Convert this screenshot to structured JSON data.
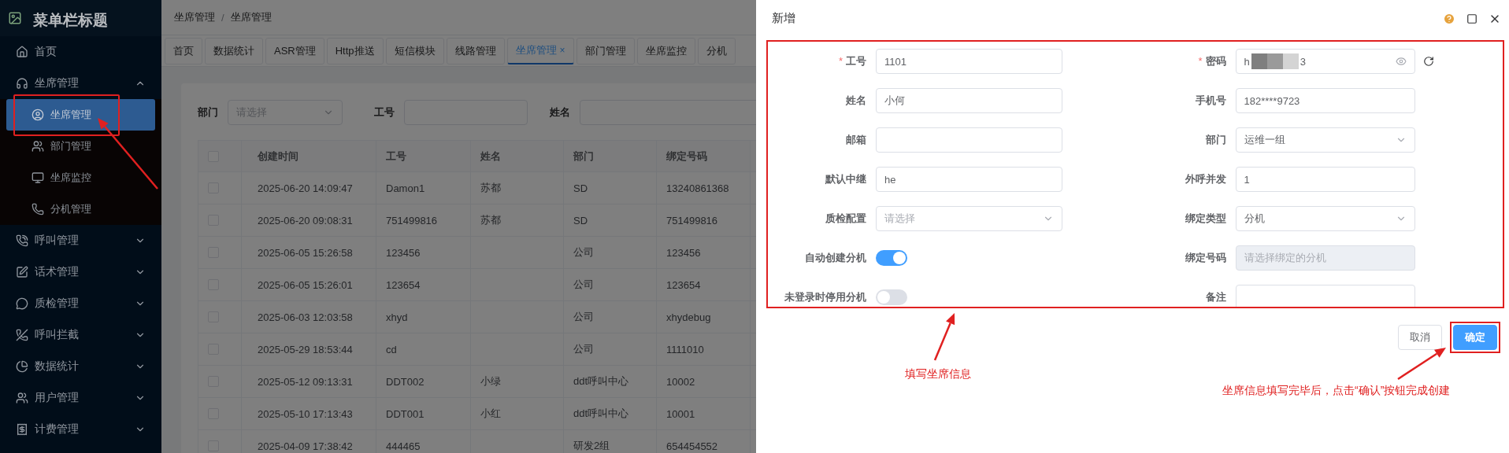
{
  "sidebar": {
    "title": "菜单栏标题",
    "items": [
      {
        "label": "首页",
        "kind": "link",
        "selected": false
      },
      {
        "label": "坐席管理",
        "kind": "group",
        "selected": false,
        "expanded": true,
        "children": [
          {
            "label": "坐席管理",
            "selected": true
          },
          {
            "label": "部门管理",
            "selected": false
          },
          {
            "label": "坐席监控",
            "selected": false
          },
          {
            "label": "分机管理",
            "selected": false
          }
        ]
      },
      {
        "label": "呼叫管理",
        "kind": "group",
        "selected": false,
        "expanded": false
      },
      {
        "label": "话术管理",
        "kind": "group",
        "selected": false,
        "expanded": false
      },
      {
        "label": "质检管理",
        "kind": "group",
        "selected": false,
        "expanded": false
      },
      {
        "label": "呼叫拦截",
        "kind": "group",
        "selected": false,
        "expanded": false
      },
      {
        "label": "数据统计",
        "kind": "group",
        "selected": false,
        "expanded": false
      },
      {
        "label": "用户管理",
        "kind": "group",
        "selected": false,
        "expanded": false
      },
      {
        "label": "计费管理",
        "kind": "group",
        "selected": false,
        "expanded": false
      }
    ]
  },
  "breadcrumb": {
    "items": [
      "坐席管理",
      "坐席管理"
    ],
    "separator": "/"
  },
  "tabs": [
    {
      "label": "首页",
      "selected": false
    },
    {
      "label": "数据统计",
      "selected": false
    },
    {
      "label": "ASR管理",
      "selected": false
    },
    {
      "label": "Http推送",
      "selected": false
    },
    {
      "label": "短信模块",
      "selected": false
    },
    {
      "label": "线路管理",
      "selected": false
    },
    {
      "label": "坐席管理",
      "selected": true,
      "close": "×"
    },
    {
      "label": "部门管理",
      "selected": false
    },
    {
      "label": "坐席监控",
      "selected": false
    },
    {
      "label": "分机",
      "selected": false
    }
  ],
  "filters": [
    {
      "label": "部门",
      "kind": "select",
      "placeholder": "请选择"
    },
    {
      "label": "工号",
      "kind": "input"
    },
    {
      "label": "姓名",
      "kind": "input"
    }
  ],
  "table": {
    "columns": [
      "创建时间",
      "工号",
      "姓名",
      "部门",
      "绑定号码"
    ],
    "all_checked": false,
    "rows": [
      {
        "checked": false,
        "created": "2025-06-20 14:09:47",
        "id": "Damon1",
        "name": "苏都",
        "dept": "SD",
        "number": "13240861368"
      },
      {
        "checked": false,
        "created": "2025-06-20 09:08:31",
        "id": "751499816",
        "name": "苏都",
        "dept": "SD",
        "number": "751499816"
      },
      {
        "checked": false,
        "created": "2025-06-05 15:26:58",
        "id": "123456",
        "dept": "公司",
        "number": "123456"
      },
      {
        "checked": false,
        "created": "2025-06-05 15:26:01",
        "id": "123654",
        "dept": "公司",
        "number": "123654"
      },
      {
        "checked": false,
        "created": "2025-06-03 12:03:58",
        "id": "xhyd",
        "dept": "公司",
        "number": "xhydebug"
      },
      {
        "checked": false,
        "created": "2025-05-29 18:53:44",
        "id": "cd",
        "dept": "公司",
        "number": "1111010"
      },
      {
        "checked": false,
        "created": "2025-05-12 09:13:31",
        "id": "DDT002",
        "name": "小绿",
        "dept": "ddt呼叫中心",
        "number": "10002"
      },
      {
        "checked": false,
        "created": "2025-05-10 17:13:43",
        "id": "DDT001",
        "name": "小红",
        "dept": "ddt呼叫中心",
        "number": "10001"
      },
      {
        "checked": false,
        "created": "2025-04-09 17:38:42",
        "id": "444465",
        "dept": "研发2组",
        "number": "654454552"
      }
    ]
  },
  "dialog": {
    "title": "新增",
    "required_mark": "*",
    "fields": [
      {
        "label": "工号",
        "kind": "input",
        "required": true,
        "value": "1101"
      },
      {
        "label": "密码",
        "kind": "password",
        "required": true,
        "value_start": "h",
        "value_end": "3"
      },
      {
        "label": "姓名",
        "kind": "input",
        "value": "小何"
      },
      {
        "label": "手机号",
        "kind": "input",
        "value": "182****9723"
      },
      {
        "label": "邮箱",
        "kind": "input"
      },
      {
        "label": "部门",
        "kind": "select",
        "value": "运维一组"
      },
      {
        "label": "默认中继",
        "kind": "input",
        "value": "he"
      },
      {
        "label": "外呼并发",
        "kind": "input",
        "value": "1"
      },
      {
        "label": "质检配置",
        "kind": "select",
        "placeholder": "请选择"
      },
      {
        "label": "绑定类型",
        "kind": "select",
        "value": "分机"
      },
      {
        "label": "自动创建分机",
        "kind": "switch",
        "on": true
      },
      {
        "label": "绑定号码",
        "kind": "input",
        "disabled": true,
        "placeholder": "请选择绑定的分机"
      },
      {
        "label": "未登录时停用分机",
        "kind": "switch",
        "on": false
      },
      {
        "label": "备注",
        "kind": "input"
      }
    ],
    "buttons": [
      {
        "label": "取消",
        "kind": "default"
      },
      {
        "label": "确定",
        "kind": "primary"
      }
    ]
  },
  "annotations": [
    {
      "text": "填写坐席信息"
    },
    {
      "text": "坐席信息填写完毕后，点击“确认”按钮完成创建"
    }
  ]
}
